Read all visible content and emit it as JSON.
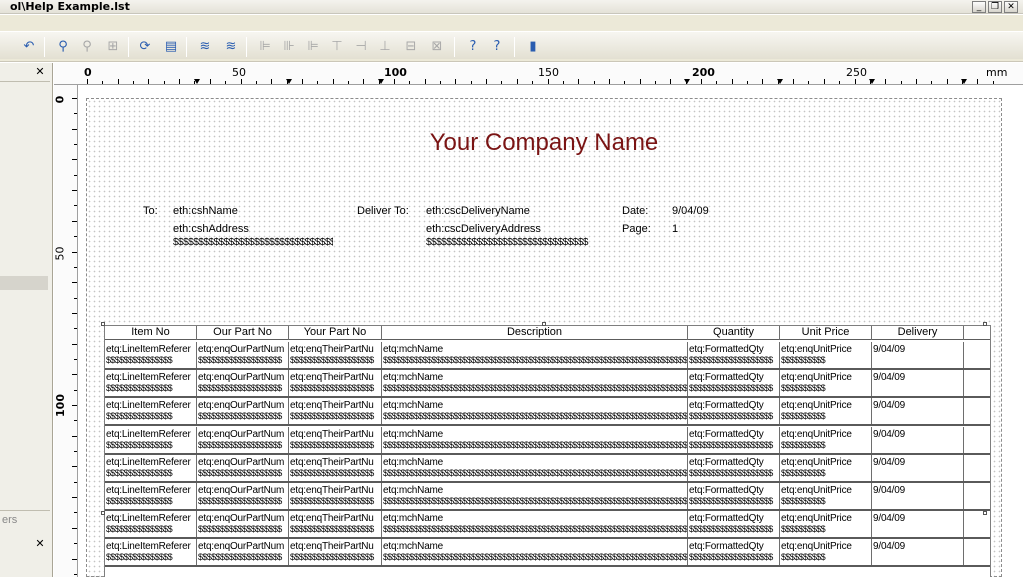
{
  "window": {
    "title": "ol\\Help Example.lst",
    "buttons": [
      "_",
      "❐",
      "✕"
    ]
  },
  "toolbar": {
    "icons": [
      {
        "name": "undo-icon",
        "glyph": "↶",
        "dim": false
      },
      {
        "name": "zoom-in-icon",
        "glyph": "⚲",
        "dim": false
      },
      {
        "name": "zoom-out-icon",
        "glyph": "⚲",
        "dim": true
      },
      {
        "name": "zoom-reset-icon",
        "glyph": "⊞",
        "dim": true
      },
      {
        "name": "refresh-icon",
        "glyph": "⟳",
        "dim": false
      },
      {
        "name": "properties-icon",
        "glyph": "▤",
        "dim": false
      },
      {
        "name": "bring-front-icon",
        "glyph": "≋",
        "dim": false
      },
      {
        "name": "send-back-icon",
        "glyph": "≋",
        "dim": false
      },
      {
        "name": "align-left-icon",
        "glyph": "⊫",
        "dim": true
      },
      {
        "name": "align-center-icon",
        "glyph": "⊪",
        "dim": true
      },
      {
        "name": "align-right-icon",
        "glyph": "⊫",
        "dim": true
      },
      {
        "name": "align-top-icon",
        "glyph": "⊤",
        "dim": true
      },
      {
        "name": "align-middle-icon",
        "glyph": "⊣",
        "dim": true
      },
      {
        "name": "align-bottom-icon",
        "glyph": "⊥",
        "dim": true
      },
      {
        "name": "same-width-icon",
        "glyph": "⊟",
        "dim": true
      },
      {
        "name": "same-size-icon",
        "glyph": "⊠",
        "dim": true
      },
      {
        "name": "help-icon",
        "glyph": "?",
        "dim": false
      },
      {
        "name": "context-help-icon",
        "glyph": "?",
        "dim": false
      },
      {
        "name": "exit-icon",
        "glyph": "▮",
        "dim": false
      }
    ]
  },
  "leftpanel": {
    "close_top": "✕",
    "close_bottom": "✕",
    "partial_label": "ers"
  },
  "ruler": {
    "unit": "mm",
    "h_labels": [
      "0",
      "50",
      "100",
      "150",
      "200",
      "250"
    ],
    "v_labels": [
      "0",
      "50",
      "100"
    ]
  },
  "report": {
    "company_name": "Your Company Name",
    "to_label": "To:",
    "to_name": "eth:cshName",
    "to_address": "eth:cshAddress",
    "to_filler": "$$$$$$$$$$$$$$$$$$$$$$$$$$$$$$$$",
    "deliver_label": "Deliver To:",
    "deliver_name": "eth:cscDeliveryName",
    "deliver_address": "eth:cscDeliveryAddress",
    "deliver_filler": "$$$$$$$$$$$$$$$$$$$$$$$$$$$$$$$$",
    "date_label": "Date:",
    "date_value": "9/04/09",
    "page_label": "Page:",
    "page_value": "1"
  },
  "table": {
    "headers": [
      "Item No",
      "Our Part No",
      "Your Part No",
      "Description",
      "Quantity",
      "Unit Price",
      "Delivery"
    ],
    "row_template": {
      "line1": [
        "etq:LineItemReferer",
        "etq:enqOurPartNum",
        "etq:enqTheirPartNu",
        "etq:mchName",
        "etq:FormattedQty",
        "etq:enqUnitPrice",
        "9/04/09"
      ],
      "line2": [
        "$$$$$$$$$$$$$$$",
        "$$$$$$$$$$$$$$$$$$$",
        "$$$$$$$$$$$$$$$$$$$",
        "$$$$$$$$$$$$$$$$$$$$$$$$$$$$$$$$$$$$$$$$$$$$$$$$$$$$$$$$$$$$$$$$$$$$$$$",
        "$$$$$$$$$$$$$$$$$$$",
        "$$$$$$$$$$",
        ""
      ]
    },
    "row_count": 8
  }
}
